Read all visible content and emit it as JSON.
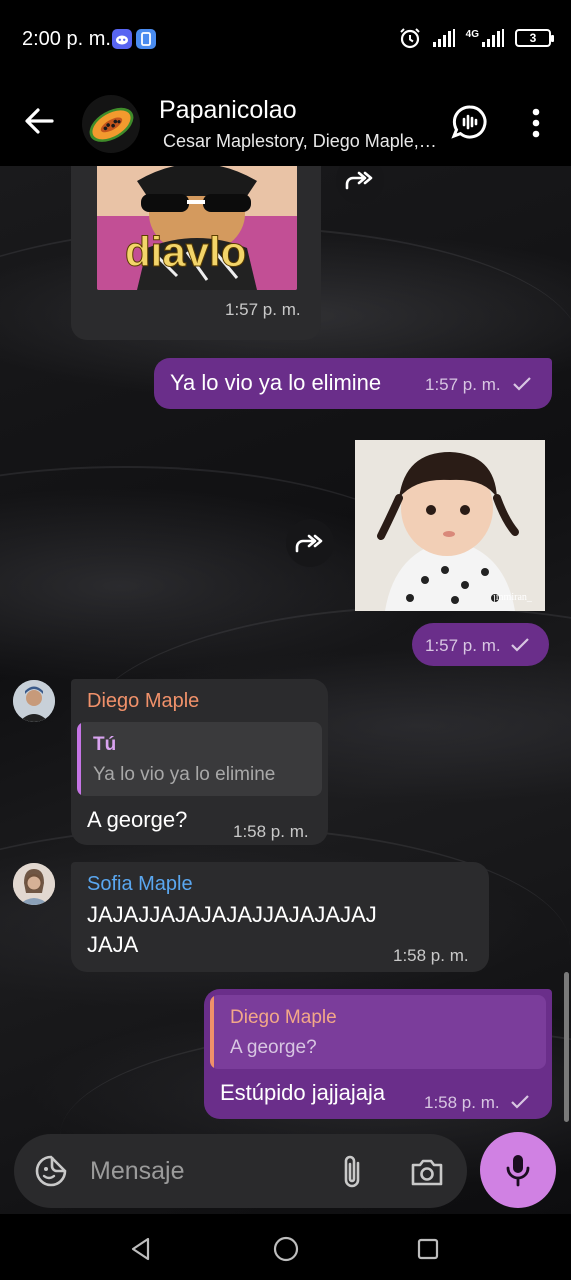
{
  "status_bar": {
    "time": "2:00 p. m.",
    "network_label": "4G",
    "battery": "3",
    "icons": [
      "discord-icon",
      "app-icon",
      "alarm-icon",
      "signal-icon",
      "signal-4g-icon",
      "battery-icon"
    ]
  },
  "header": {
    "title": "Papanicolao",
    "subtitle": "Cesar Maplestory, Diego Maple, Sofia Maple",
    "icons": [
      "back-arrow-icon",
      "papaya-avatar",
      "voice-chat-icon",
      "more-vert-icon"
    ]
  },
  "messages": [
    {
      "id": "m1",
      "direction": "in",
      "type": "sticker",
      "sticker_caption": "diavlo",
      "time": "1:57 p. m."
    },
    {
      "id": "m2",
      "direction": "out",
      "type": "text",
      "text": "Ya lo vio ya lo elimine",
      "time": "1:57 p. m.",
      "read": true
    },
    {
      "id": "m3",
      "direction": "out",
      "type": "image",
      "image_watermark": "jinmiran_",
      "time": "1:57 p. m.",
      "read": true
    },
    {
      "id": "m4",
      "direction": "in",
      "sender": "Diego Maple",
      "sender_color": "#f0916a",
      "reply": {
        "name": "Tú",
        "text": "Ya lo vio ya lo elimine",
        "accent": "#c675e6"
      },
      "text": "A george?",
      "time": "1:58 p. m."
    },
    {
      "id": "m5",
      "direction": "in",
      "sender": "Sofia Maple",
      "sender_color": "#5aa7f0",
      "text_line1": "JAJAJJAJAJAJAJJAJAJAJAJ",
      "text_line2": "JAJA",
      "time": "1:58 p. m."
    },
    {
      "id": "m6",
      "direction": "out",
      "reply": {
        "name": "Diego Maple",
        "text": "A george?",
        "accent": "#f0916a"
      },
      "text": "Estúpido jajjajaja",
      "time": "1:58 p. m.",
      "read": true
    }
  ],
  "input": {
    "placeholder": "Mensaje",
    "icons": [
      "sticker-icon",
      "attach-icon",
      "camera-icon",
      "mic-icon"
    ]
  },
  "nav": {
    "icons": [
      "nav-back-icon",
      "nav-home-icon",
      "nav-recents-icon"
    ]
  },
  "colors": {
    "outgoing_bubble": "#6a2e8a",
    "incoming_bubble": "#2b2b2d",
    "accent_mic": "#d081e3"
  }
}
